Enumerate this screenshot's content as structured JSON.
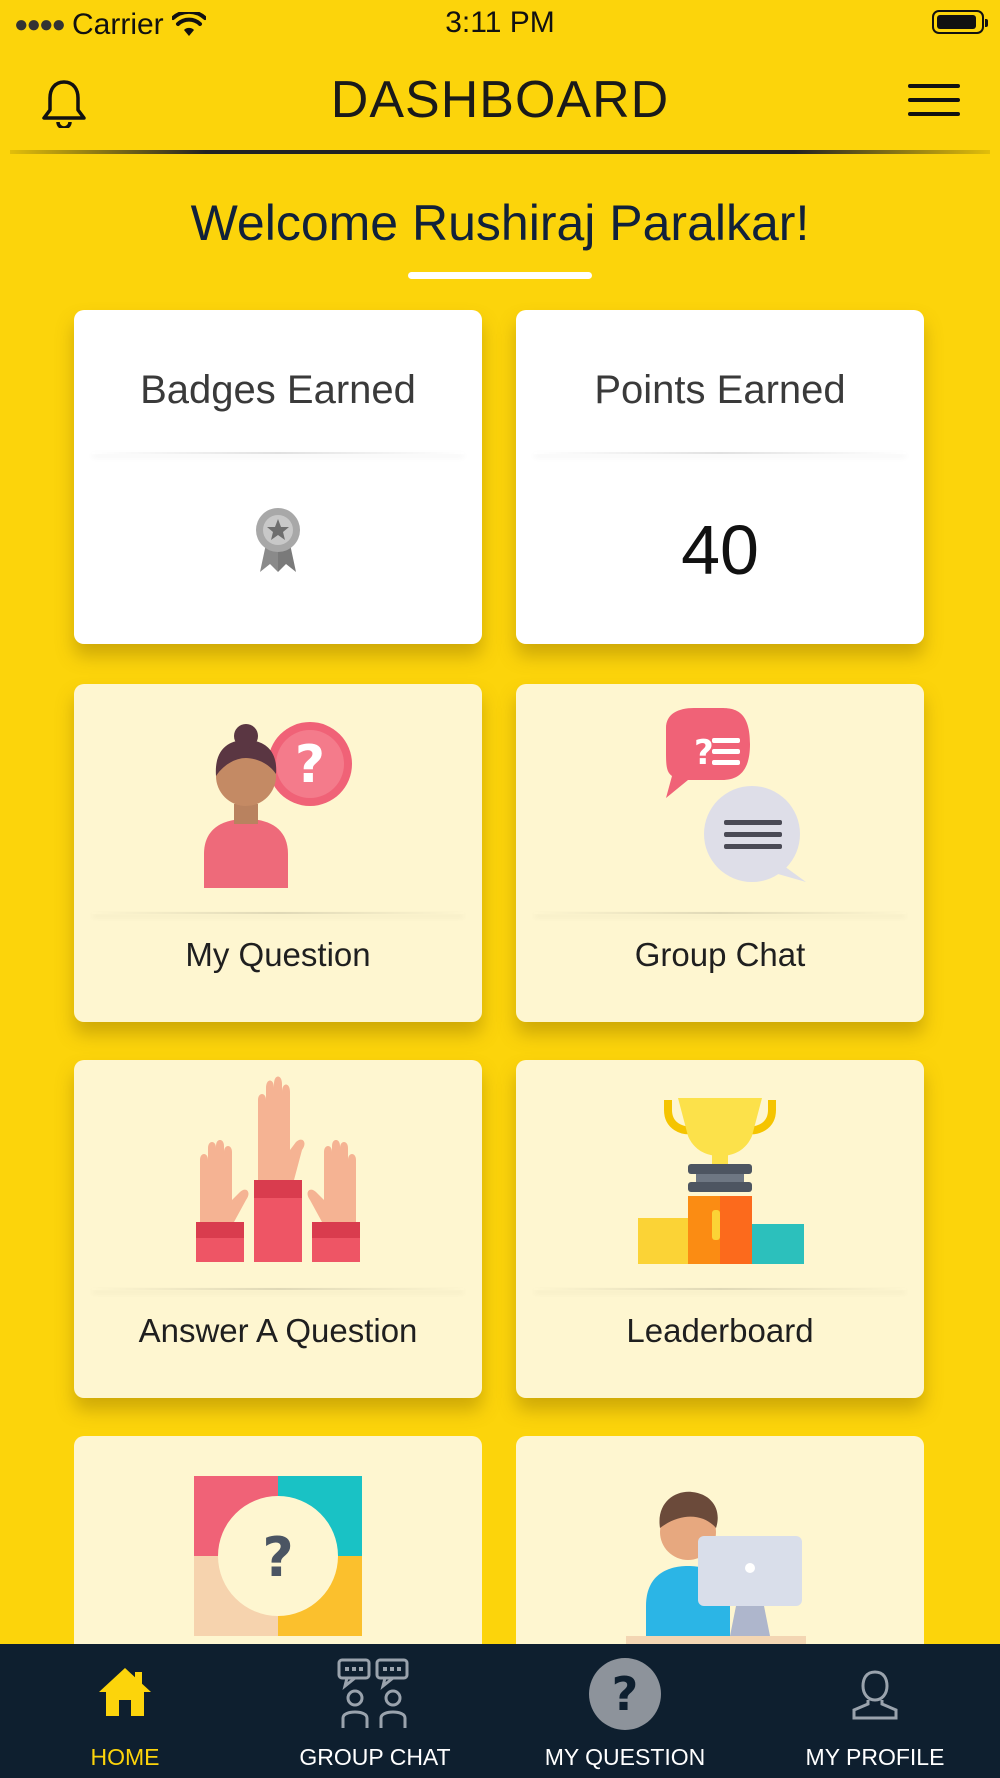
{
  "status_bar": {
    "carrier": "Carrier",
    "time": "3:11 PM"
  },
  "header": {
    "title": "DASHBOARD"
  },
  "welcome": "Welcome Rushiraj Paralkar!",
  "stats": {
    "badges": {
      "title": "Badges Earned"
    },
    "points": {
      "title": "Points Earned",
      "value": "40"
    }
  },
  "tiles": [
    {
      "label": "My Question"
    },
    {
      "label": "Group Chat"
    },
    {
      "label": "Answer A Question"
    },
    {
      "label": "Leaderboard"
    }
  ],
  "nav": [
    {
      "label": "HOME",
      "active": true
    },
    {
      "label": "GROUP CHAT"
    },
    {
      "label": "MY QUESTION"
    },
    {
      "label": "MY PROFILE"
    }
  ],
  "colors": {
    "background": "#FCD40B",
    "nav_bg": "#0E1F2F",
    "active": "#FCD40B",
    "tile_bg": "#FEF6D0"
  }
}
